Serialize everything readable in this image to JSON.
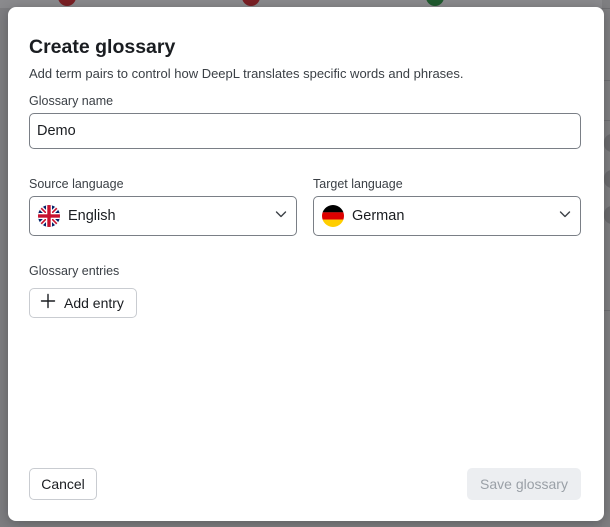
{
  "dialog": {
    "title": "Create glossary",
    "subtitle": "Add term pairs to control how DeepL translates specific words and phrases."
  },
  "glossary_name": {
    "label": "Glossary name",
    "value": "Demo"
  },
  "source_language": {
    "label": "Source language",
    "selected": "English",
    "flag": "uk-flag-icon"
  },
  "target_language": {
    "label": "Target language",
    "selected": "German",
    "flag": "germany-flag-icon"
  },
  "entries": {
    "label": "Glossary entries",
    "add_button_label": "Add entry"
  },
  "footer": {
    "cancel_label": "Cancel",
    "save_label": "Save glossary",
    "save_disabled": true
  },
  "colors": {
    "overlay": "#7d7d80",
    "border": "#7a7f86",
    "disabled_bg": "#eceef1",
    "disabled_text": "#9aa0a7"
  }
}
